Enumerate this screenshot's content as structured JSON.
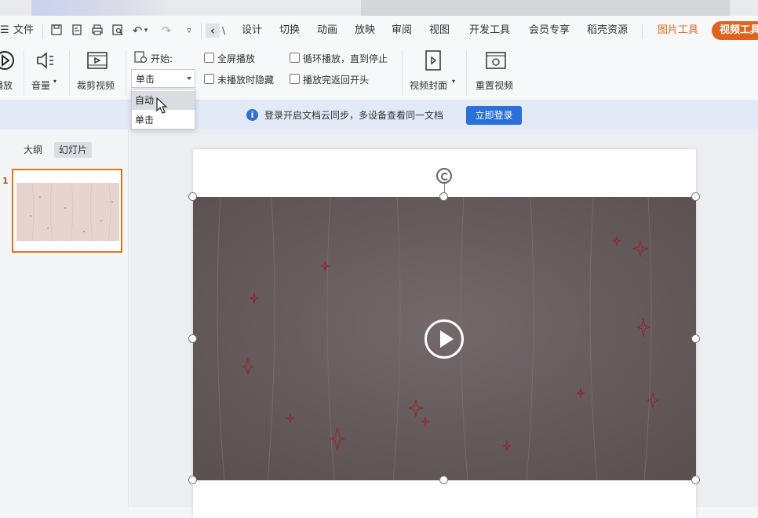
{
  "menu": {
    "file_label": "文件",
    "tabs": [
      "设计",
      "切换",
      "动画",
      "放映",
      "审阅",
      "视图",
      "开发工具",
      "会员专享",
      "稻壳资源"
    ],
    "picture_tools": "图片工具",
    "video_tools": "视频工具"
  },
  "ribbon": {
    "play_label": "播放",
    "volume_label": "音量",
    "trim_label": "裁剪视频",
    "start_label": "开始:",
    "start_value": "单击",
    "fullscreen_label": "全屏播放",
    "hide_label": "未播放时隐藏",
    "loop_label": "循环播放，直到停止",
    "rewind_label": "播放完返回开头",
    "cover_label": "视频封面",
    "reset_label": "重置视频"
  },
  "dropdown": {
    "options": [
      "自动",
      "单击"
    ],
    "hovered": "自动"
  },
  "notify": {
    "message": "登录开启文档云同步，多设备查看同一文档",
    "button": "立即登录"
  },
  "panel": {
    "tab_outline": "大纲",
    "tab_slides": "幻灯片",
    "slide_number": "1"
  },
  "colors": {
    "accent": "#e2621b",
    "login_blue": "#2b6fd8",
    "video_bg": "#6a5f5c",
    "sparkle": "#8c2a35"
  }
}
